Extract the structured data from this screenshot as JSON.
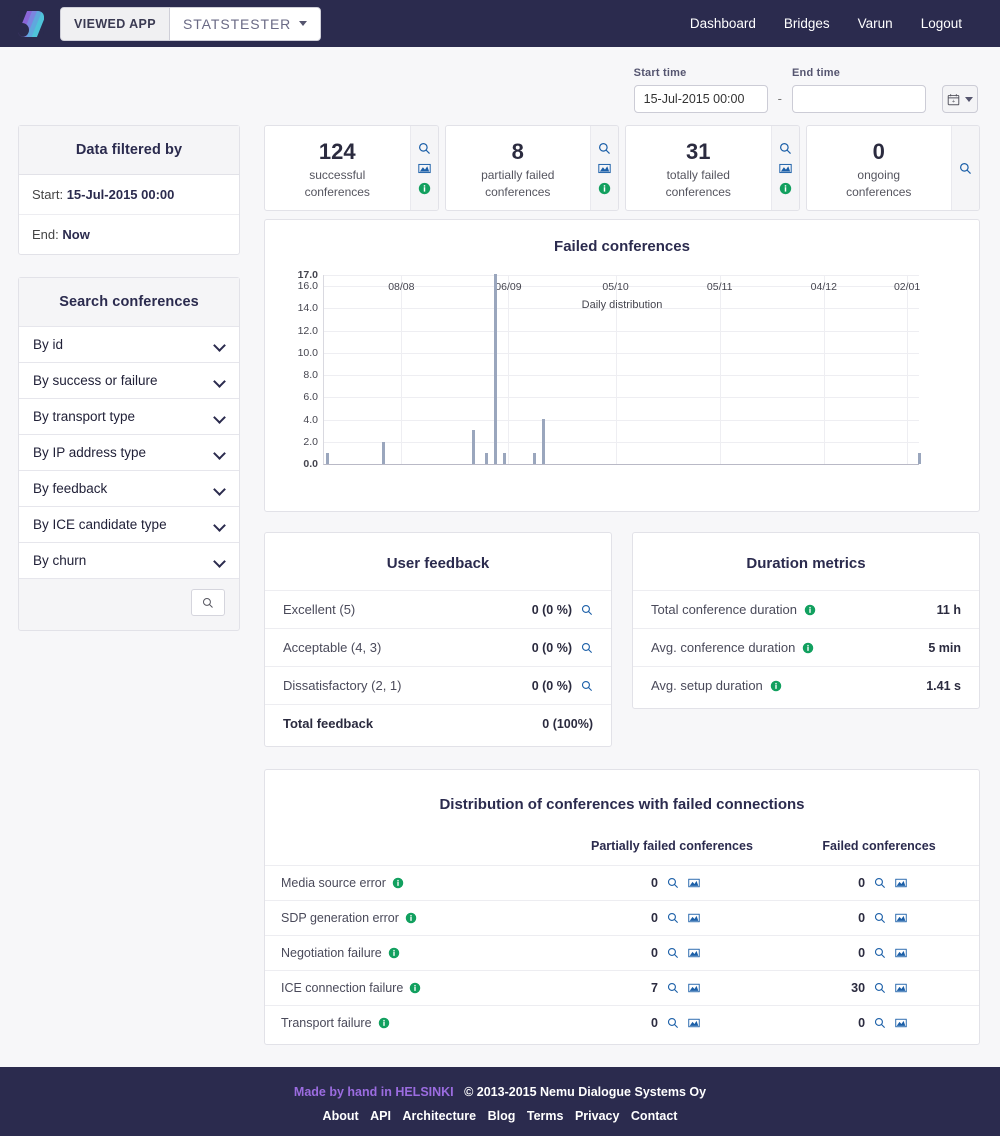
{
  "navbar": {
    "logo_name": "app-logo",
    "app_switcher": {
      "label": "VIEWED APP",
      "value": "STATSTESTER"
    },
    "links": [
      {
        "label": "Dashboard"
      },
      {
        "label": "Bridges"
      },
      {
        "label": "Varun"
      },
      {
        "label": "Logout"
      }
    ]
  },
  "datebar": {
    "start_label": "Start time",
    "start_value": "15-Jul-2015 00:00",
    "start_placeholder": "",
    "separator": "-",
    "end_label": "End time",
    "end_value": "",
    "end_placeholder": "",
    "calendar_icon": "calendar-icon"
  },
  "sidebar": {
    "filter_panel": {
      "title": "Data filtered by",
      "rows": [
        {
          "label": "Start:",
          "value": "15-Jul-2015 00:00"
        },
        {
          "label": "End:",
          "value": "Now"
        }
      ]
    },
    "search_panel": {
      "title": "Search conferences",
      "items": [
        {
          "label": "By id"
        },
        {
          "label": "By success or failure"
        },
        {
          "label": "By transport type"
        },
        {
          "label": "By IP address type"
        },
        {
          "label": "By feedback"
        },
        {
          "label": "By ICE candidate type"
        },
        {
          "label": "By churn"
        }
      ],
      "search_button_icon": "search-icon"
    }
  },
  "cards": [
    {
      "value": "124",
      "line1": "successful",
      "line2": "conferences",
      "icons": [
        "search-icon",
        "chart-icon",
        "info-icon"
      ]
    },
    {
      "value": "8",
      "line1": "partially failed",
      "line2": "conferences",
      "icons": [
        "search-icon",
        "chart-icon",
        "info-icon"
      ]
    },
    {
      "value": "31",
      "line1": "totally failed",
      "line2": "conferences",
      "icons": [
        "search-icon",
        "chart-icon",
        "info-icon"
      ]
    },
    {
      "value": "0",
      "line1": "ongoing",
      "line2": "conferences",
      "icons": [
        "search-icon"
      ]
    }
  ],
  "chart_data": {
    "type": "bar",
    "title": "Failed conferences",
    "xlabel": "Daily distribution",
    "ylabel": "",
    "ylim": [
      0,
      17
    ],
    "grid": true,
    "legend": null,
    "ytick_labels": [
      "17.0",
      "16.0",
      "14.0",
      "12.0",
      "10.0",
      "8.0",
      "6.0",
      "4.0",
      "2.0",
      "0.0"
    ],
    "ytick_values": [
      17,
      16,
      14,
      12,
      10,
      8,
      6,
      4,
      2,
      0
    ],
    "xtick_labels": [
      "08/08",
      "06/09",
      "05/10",
      "05/11",
      "04/12",
      "02/01"
    ],
    "xtick_positions": [
      0.13,
      0.31,
      0.49,
      0.665,
      0.84,
      0.98
    ],
    "bars": [
      {
        "x": 0.004,
        "value": 1
      },
      {
        "x": 0.098,
        "value": 2
      },
      {
        "x": 0.249,
        "value": 3
      },
      {
        "x": 0.271,
        "value": 1
      },
      {
        "x": 0.285,
        "value": 17
      },
      {
        "x": 0.301,
        "value": 1
      },
      {
        "x": 0.352,
        "value": 1
      },
      {
        "x": 0.366,
        "value": 4
      },
      {
        "x": 0.998,
        "value": 1
      }
    ]
  },
  "user_feedback": {
    "title": "User feedback",
    "rows": [
      {
        "label": "Excellent (5)",
        "value": "0 (0 %)",
        "icon": "search-icon"
      },
      {
        "label": "Acceptable (4, 3)",
        "value": "0 (0 %)",
        "icon": "search-icon"
      },
      {
        "label": "Dissatisfactory (2, 1)",
        "value": "0 (0 %)",
        "icon": "search-icon"
      }
    ],
    "total": {
      "label": "Total feedback",
      "value": "0 (100%)"
    }
  },
  "duration_metrics": {
    "title": "Duration metrics",
    "rows": [
      {
        "label": "Total conference duration",
        "icon": "info-icon",
        "value": "11 h"
      },
      {
        "label": "Avg. conference duration",
        "icon": "info-icon",
        "value": "5 min"
      },
      {
        "label": "Avg. setup duration",
        "icon": "info-icon",
        "value": "1.41 s"
      }
    ]
  },
  "distribution_table": {
    "title": "Distribution of conferences with failed connections",
    "columns": [
      "",
      "Partially failed conferences",
      "Failed conferences"
    ],
    "rows": [
      {
        "label": "Media source error",
        "partial": "0",
        "failed": "0"
      },
      {
        "label": "SDP generation error",
        "partial": "0",
        "failed": "0"
      },
      {
        "label": "Negotiation failure",
        "partial": "0",
        "failed": "0"
      },
      {
        "label": "ICE connection failure",
        "partial": "7",
        "failed": "30"
      },
      {
        "label": "Transport failure",
        "partial": "0",
        "failed": "0"
      }
    ]
  },
  "footer": {
    "made_by": "Made by hand in HELSINKI",
    "made_by_prefix": "Made by hand in ",
    "made_by_city": "HELSINKI",
    "copyright": "© 2013-2015 Nemu Dialogue Systems Oy",
    "links": [
      {
        "label": "About"
      },
      {
        "label": "API"
      },
      {
        "label": "Architecture"
      },
      {
        "label": "Blog"
      },
      {
        "label": "Terms"
      },
      {
        "label": "Privacy"
      },
      {
        "label": "Contact"
      }
    ]
  },
  "colors": {
    "navy": "#2b2b4e",
    "icon_blue": "#1b5fa8",
    "icon_green": "#12a05f",
    "bar": "#9aa6bd",
    "helsinki_purple": "#9b6ce0"
  }
}
